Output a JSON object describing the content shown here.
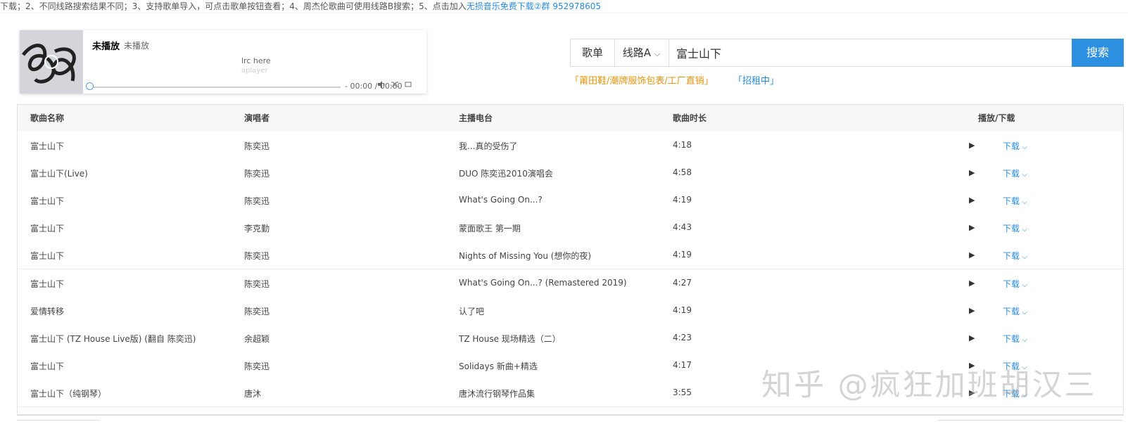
{
  "notice": {
    "text": "下载；2、不同线路搜索结果不同；3、支持歌单导入，可点击歌单按钮查看；4、周杰伦歌曲可使用线路B搜索；5、点击加入",
    "link": "无损音乐免费下载②群 952978605"
  },
  "player": {
    "title": "未播放",
    "artist": "未播放",
    "lrc": "lrc here",
    "lrc_sub": "aplayer",
    "time": "- 00:00 / 00:00",
    "progress": 0
  },
  "search": {
    "songlist_label": "歌单",
    "route_label": "线路A",
    "query": "富士山下",
    "button_label": "搜索"
  },
  "ads": [
    "「莆田鞋/潮牌服饰包表/工厂直销」",
    "「招租中」"
  ],
  "table": {
    "headers": [
      "歌曲名称",
      "演唱者",
      "主播电台",
      "歌曲时长",
      "播放/下载"
    ],
    "download_label": "下载",
    "rows": [
      {
        "name": "富士山下",
        "artist": "陈奕迅",
        "album": "我...真的受伤了",
        "duration": "4:18"
      },
      {
        "name": "富士山下(Live)",
        "artist": "陈奕迅",
        "album": "DUO 陈奕迅2010演唱会",
        "duration": "4:58"
      },
      {
        "name": "富士山下",
        "artist": "陈奕迅",
        "album": "What's Going On...?",
        "duration": "4:19"
      },
      {
        "name": "富士山下",
        "artist": "李克勤",
        "album": "蒙面歌王 第一期",
        "duration": "4:43"
      },
      {
        "name": "富士山下",
        "artist": "陈奕迅",
        "album": "Nights of Missing You (想你的夜)",
        "duration": "4:19"
      },
      {
        "name": "富士山下",
        "artist": "陈奕迅",
        "album": "What's Going On...? (Remastered 2019)",
        "duration": "4:27"
      },
      {
        "name": "爱情转移",
        "artist": "陈奕迅",
        "album": "认了吧",
        "duration": "4:19"
      },
      {
        "name": "富士山下 (TZ House Live版) (翻自 陈奕迅)",
        "artist": "余超颖",
        "album": "TZ House 现场精选（二）",
        "duration": "4:23"
      },
      {
        "name": "富士山下",
        "artist": "陈奕迅",
        "album": "Solidays 新曲+精选",
        "duration": "4:17"
      },
      {
        "name": "富士山下（纯钢琴）",
        "artist": "唐沐",
        "album": "唐沐流行钢琴作品集",
        "duration": "3:55"
      }
    ]
  },
  "watermark": "知乎 @疯狂加班胡汉三",
  "icons": {
    "play": "play-icon",
    "volume": "volume-icon",
    "shuffle": "shuffle-icon",
    "loop": "loop-icon",
    "chevron": "chevron-down-icon"
  },
  "colors": {
    "accent": "#2c8fe0",
    "link": "#2b8ad8",
    "ad": "#e6940f"
  }
}
